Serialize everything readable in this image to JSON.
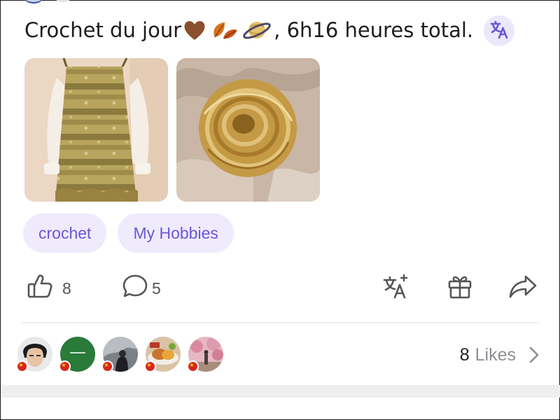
{
  "post": {
    "text_before": "Crochet du jour",
    "text_after": ", 6h16 heures total."
  },
  "tags": [
    {
      "label": "crochet"
    },
    {
      "label": "My Hobbies"
    }
  ],
  "actions": {
    "like_count": "8",
    "comment_count": "5"
  },
  "likes": {
    "count": "8",
    "label": "Likes"
  },
  "icons": {
    "translate": "translate-icon",
    "like": "thumbs-up-icon",
    "comment": "comment-icon",
    "translate_add": "translate-add-icon",
    "gift": "gift-icon",
    "share": "share-icon",
    "chevron": "chevron-right-icon"
  },
  "colors": {
    "accent": "#6d56d6",
    "tag_bg": "#efebfd",
    "icon_grey": "#555555",
    "flag_red": "#d8261d"
  }
}
